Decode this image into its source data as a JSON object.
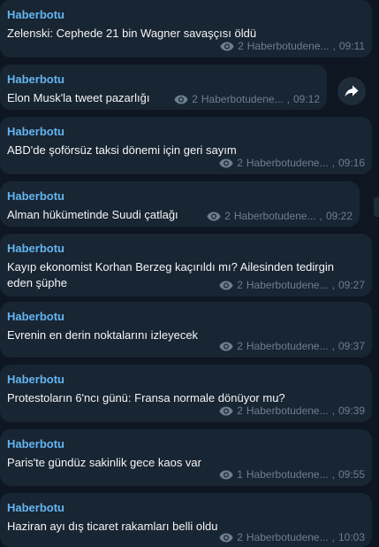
{
  "messages": [
    {
      "sender": "Haberbotu",
      "text": "Zelenski: Cephede 21 bin Wagner savaşçısı öldü",
      "views": "2",
      "channel": "Haberbotudene...",
      "time": "09:11"
    },
    {
      "sender": "Haberbotu",
      "text": "Elon Musk'la tweet pazarlığı",
      "views": "2",
      "channel": "Haberbotudene...",
      "time": "09:12"
    },
    {
      "sender": "Haberbotu",
      "text": "ABD'de şoförsüz taksi dönemi için geri sayım",
      "views": "2",
      "channel": "Haberbotudene...",
      "time": "09:16"
    },
    {
      "sender": "Haberbotu",
      "text": "Alman hükümetinde Suudi çatlağı",
      "views": "2",
      "channel": "Haberbotudene...",
      "time": "09:22"
    },
    {
      "sender": "Haberbotu",
      "text": "Kayıp ekonomist Korhan Berzeg kaçırıldı mı? Ailesinden tedirgin eden şüphe",
      "views": "2",
      "channel": "Haberbotudene...",
      "time": "09:27"
    },
    {
      "sender": "Haberbotu",
      "text": "Evrenin en derin noktalarını izleyecek",
      "views": "2",
      "channel": "Haberbotudene...",
      "time": "09:37"
    },
    {
      "sender": "Haberbotu",
      "text": "Protestoların 6'ncı günü: Fransa normale dönüyor mu?",
      "views": "2",
      "channel": "Haberbotudene...",
      "time": "09:39"
    },
    {
      "sender": "Haberbotu",
      "text": "Paris'te gündüz sakinlik gece kaos var",
      "views": "1",
      "channel": "Haberbotudene...",
      "time": "09:55"
    },
    {
      "sender": "Haberbotu",
      "text": "Haziran ayı dış ticaret rakamları belli oldu",
      "views": "2",
      "channel": "Haberbotudene...",
      "time": "10:03"
    }
  ],
  "icons": {
    "views": "eye-icon",
    "share": "share-arrow-icon"
  },
  "colors": {
    "background": "#0e1621",
    "bubble": "#182533",
    "sender": "#64b5ef",
    "meta": "#6d7f8f",
    "text": "#f5f5f5"
  }
}
